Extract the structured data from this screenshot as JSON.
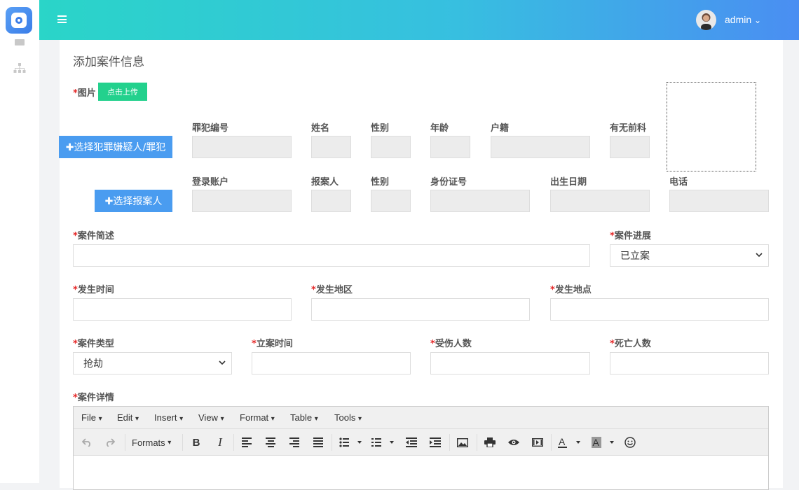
{
  "header": {
    "user": "admin",
    "user_caret": "⌄"
  },
  "page": {
    "title": "添加案件信息"
  },
  "photo": {
    "label": "图片",
    "upload_button": "点击上传"
  },
  "suspect": {
    "select_button": "✚选择犯罪嫌疑人/罪犯",
    "columns": [
      "罪犯编号",
      "姓名",
      "性别",
      "年龄",
      "户籍",
      "有无前科"
    ]
  },
  "reporter": {
    "select_button": "✚选择报案人",
    "columns": [
      "登录账户",
      "报案人",
      "性别",
      "身份证号",
      "出生日期",
      "电话"
    ]
  },
  "form": {
    "required_mark": "*",
    "summary_label": "案件简述",
    "progress_label": "案件进展",
    "progress_value": "已立案",
    "occur_time_label": "发生时间",
    "occur_area_label": "发生地区",
    "occur_place_label": "发生地点",
    "case_type_label": "案件类型",
    "case_type_value": "抢劫",
    "filing_time_label": "立案时间",
    "injured_label": "受伤人数",
    "death_label": "死亡人数",
    "detail_label": "案件详情"
  },
  "editor": {
    "menus": [
      "File",
      "Edit",
      "Insert",
      "View",
      "Format",
      "Table",
      "Tools"
    ],
    "formats_label": "Formats",
    "caret": "▾"
  },
  "icons": {
    "accent": "#4a9cf0",
    "header_gradient": [
      "#2ad5c8",
      "#4a8ef2"
    ],
    "upload_green": "#23d18d",
    "required_red": "#e52a2a"
  }
}
